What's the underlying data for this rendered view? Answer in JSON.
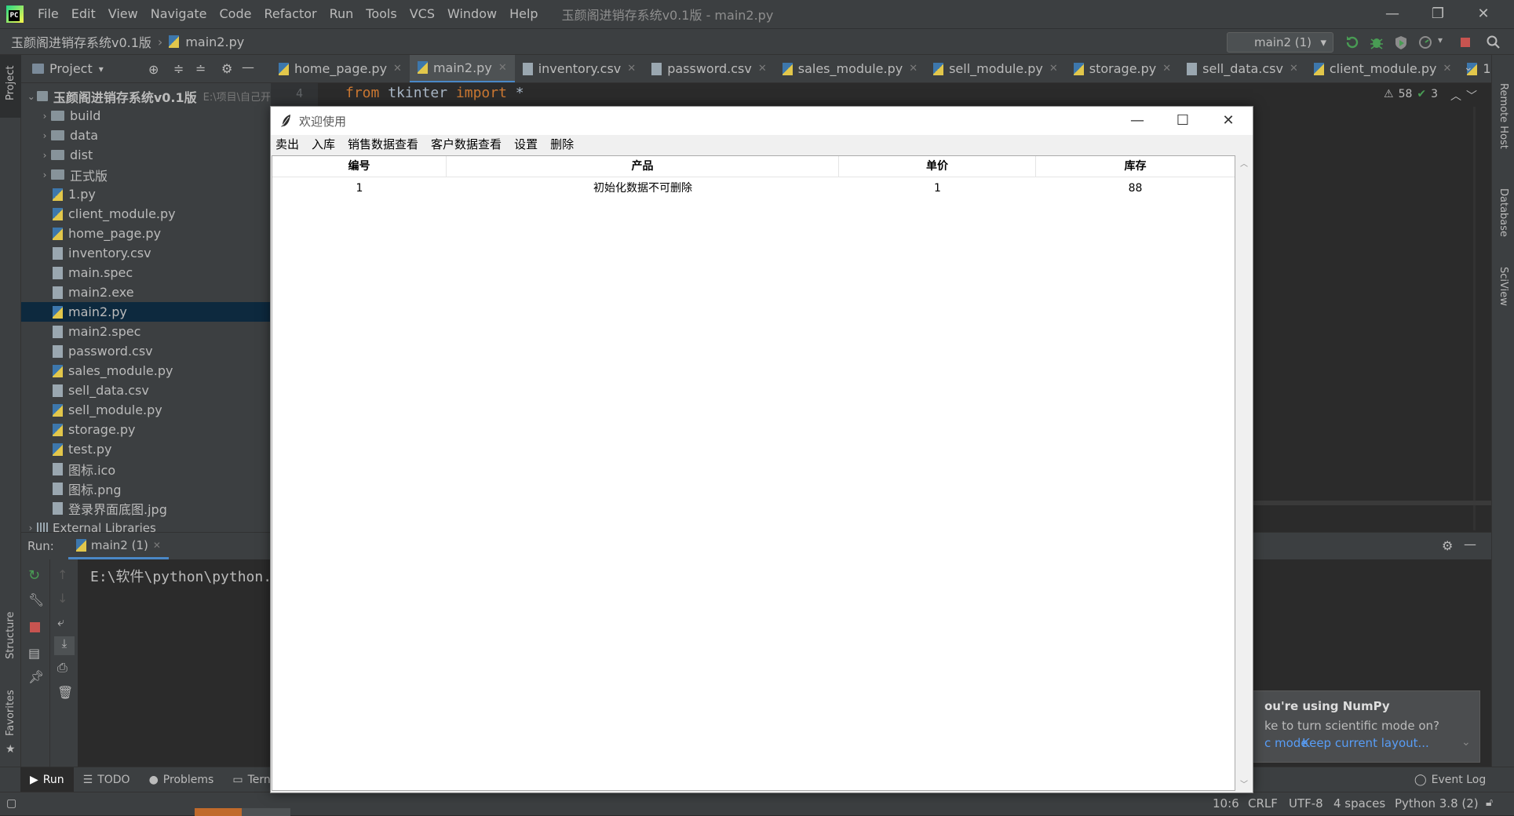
{
  "ide": {
    "menu": [
      "File",
      "Edit",
      "View",
      "Navigate",
      "Code",
      "Refactor",
      "Run",
      "Tools",
      "VCS",
      "Window",
      "Help"
    ],
    "window_title": "玉颜阁进销存系统v0.1版 - main2.py",
    "breadcrumb": {
      "project": "玉颜阁进销存系统v0.1版",
      "file": "main2.py"
    },
    "run_config": "main2 (1)",
    "project_panel": {
      "header": "Project",
      "root": {
        "name": "玉颜阁进销存系统v0.1版",
        "path": "E:\\项目\\自己开"
      },
      "items": [
        {
          "name": "build",
          "type": "folder"
        },
        {
          "name": "data",
          "type": "folder"
        },
        {
          "name": "dist",
          "type": "folder"
        },
        {
          "name": "正式版",
          "type": "folder"
        },
        {
          "name": "1.py",
          "type": "py"
        },
        {
          "name": "client_module.py",
          "type": "py"
        },
        {
          "name": "home_page.py",
          "type": "py"
        },
        {
          "name": "inventory.csv",
          "type": "file"
        },
        {
          "name": "main.spec",
          "type": "file"
        },
        {
          "name": "main2.exe",
          "type": "exe"
        },
        {
          "name": "main2.py",
          "type": "py",
          "selected": true
        },
        {
          "name": "main2.spec",
          "type": "file"
        },
        {
          "name": "password.csv",
          "type": "file"
        },
        {
          "name": "sales_module.py",
          "type": "py"
        },
        {
          "name": "sell_data.csv",
          "type": "file"
        },
        {
          "name": "sell_module.py",
          "type": "py"
        },
        {
          "name": "storage.py",
          "type": "py"
        },
        {
          "name": "test.py",
          "type": "py"
        },
        {
          "name": "图标.ico",
          "type": "file"
        },
        {
          "name": "图标.png",
          "type": "file"
        },
        {
          "name": "登录界面底图.jpg",
          "type": "file"
        }
      ],
      "external": "External Libraries"
    },
    "tabs": [
      {
        "label": "home_page.py",
        "type": "py"
      },
      {
        "label": "main2.py",
        "type": "py",
        "active": true
      },
      {
        "label": "inventory.csv",
        "type": "file"
      },
      {
        "label": "password.csv",
        "type": "file"
      },
      {
        "label": "sales_module.py",
        "type": "py"
      },
      {
        "label": "sell_module.py",
        "type": "py"
      },
      {
        "label": "storage.py",
        "type": "py"
      },
      {
        "label": "sell_data.csv",
        "type": "file"
      },
      {
        "label": "client_module.py",
        "type": "py"
      },
      {
        "label": "1",
        "type": "py"
      }
    ],
    "editor": {
      "line_number": "4",
      "code": {
        "kw1": "from",
        "mod": " tkinter ",
        "kw2": "import",
        "rest": " *"
      },
      "warnings": "58",
      "checks": "3"
    },
    "run_panel": {
      "label": "Run:",
      "tab": "main2 (1)",
      "console": "E:\\软件\\python\\python."
    },
    "toolwindows": [
      "Run",
      "TODO",
      "Problems",
      "Tern"
    ],
    "event_log": "Event Log",
    "left_stripe": [
      "Project",
      "Structure",
      "Favorites"
    ],
    "right_stripe": [
      "Remote Host",
      "Database",
      "SciView"
    ],
    "notification": {
      "title": "ou're using NumPy",
      "body": "ke to turn scientific mode on?",
      "link1": "c mode",
      "link2": "Keep current layout..."
    },
    "status": {
      "position": "10:6",
      "line_sep": "CRLF",
      "encoding": "UTF-8",
      "indent": "4 spaces",
      "interpreter": "Python 3.8 (2)"
    }
  },
  "tk_app": {
    "title": "欢迎使用",
    "menu": [
      "卖出",
      "入库",
      "销售数据查看",
      "客户数据查看",
      "设置",
      "删除"
    ],
    "columns": [
      "编号",
      "产品",
      "单价",
      "库存"
    ],
    "rows": [
      [
        "1",
        "初始化数据不可删除",
        "1",
        "88"
      ]
    ]
  }
}
